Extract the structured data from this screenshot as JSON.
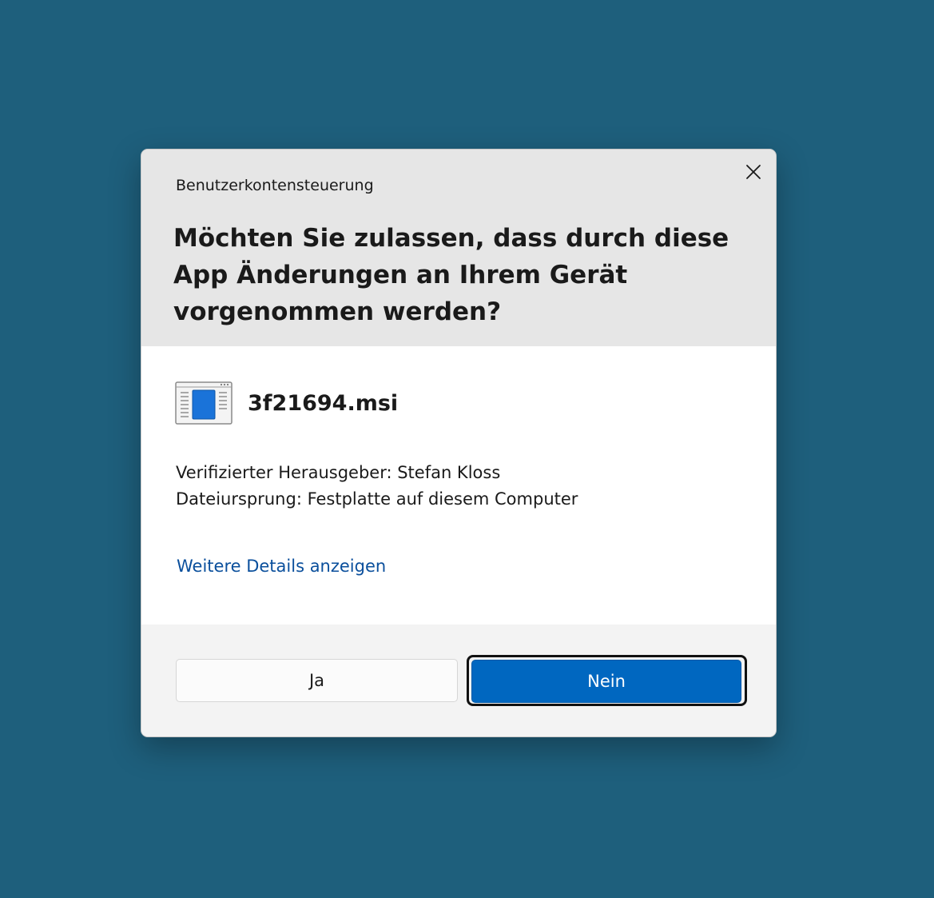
{
  "dialog": {
    "title": "Benutzerkontensteuerung",
    "question": "Möchten Sie zulassen, dass durch diese App Änderungen an Ihrem Gerät vorgenommen werden?",
    "close_icon": "close-icon"
  },
  "app": {
    "icon": "installer-window-icon",
    "name": "3f21694.msi",
    "publisher": "Verifizierter Herausgeber: Stefan Kloss",
    "origin": "Dateiursprung: Festplatte auf diesem Computer",
    "details_link": "Weitere Details anzeigen"
  },
  "buttons": {
    "yes_label": "Ja",
    "no_label": "Nein"
  },
  "colors": {
    "background": "#1e5f7c",
    "header": "#e6e6e6",
    "footer": "#f3f3f3",
    "accent": "#0067c0",
    "link": "#0a4f9c"
  }
}
